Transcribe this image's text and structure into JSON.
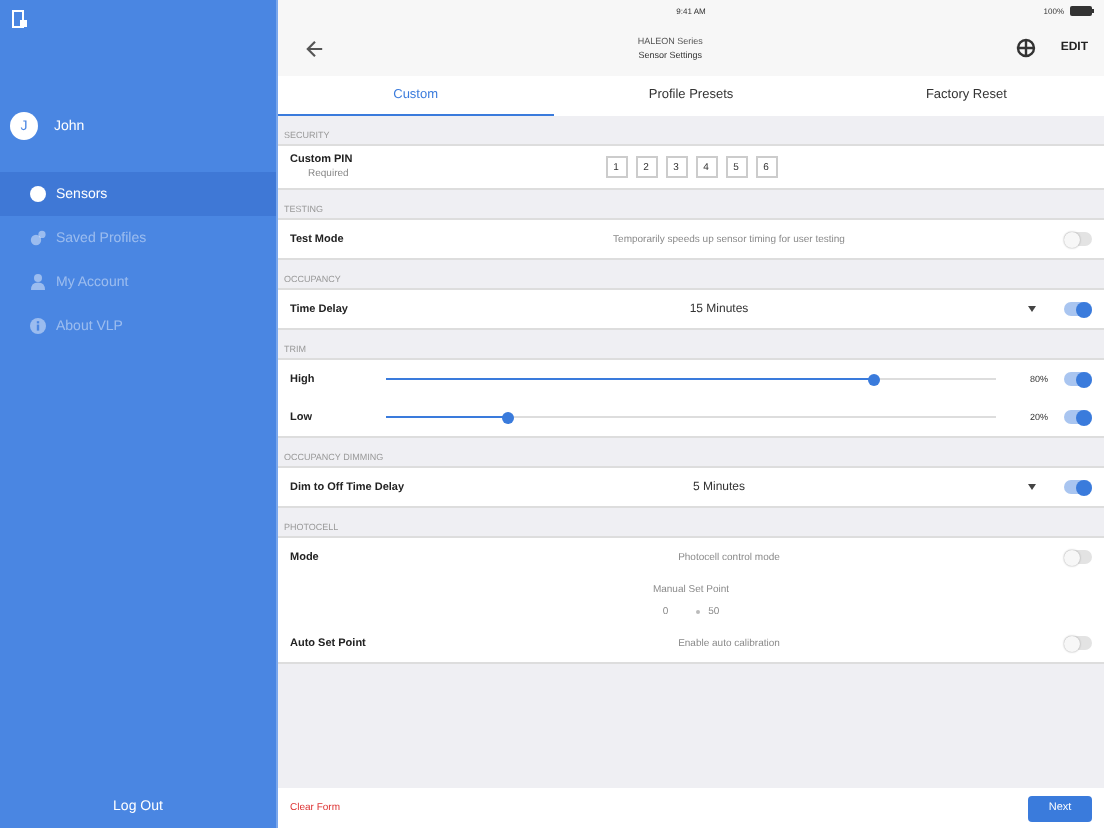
{
  "status_bar": {
    "time": "9:41 AM",
    "battery": "100%"
  },
  "sidebar": {
    "user": {
      "initial": "J",
      "name": "John"
    },
    "items": [
      {
        "label": "Sensors",
        "selected": true
      },
      {
        "label": "Saved Profiles",
        "selected": false
      },
      {
        "label": "My Account",
        "selected": false
      },
      {
        "label": "About VLP",
        "selected": false
      }
    ],
    "logout": "Log Out"
  },
  "header": {
    "subtitle": "HALEON Series",
    "title": "Sensor Settings",
    "edit": "EDIT"
  },
  "tabs": [
    {
      "label": "Custom",
      "selected": true
    },
    {
      "label": "Profile Presets",
      "selected": false
    },
    {
      "label": "Factory Reset",
      "selected": false
    }
  ],
  "sections": [
    {
      "title": "SECURITY",
      "rows": [
        {
          "kind": "pin",
          "label": "Custom PIN",
          "sublabel": "Required",
          "digits": [
            "1",
            "2",
            "3",
            "4",
            "5",
            "6"
          ]
        }
      ]
    },
    {
      "title": "TESTING",
      "rows": [
        {
          "kind": "toggle",
          "label": "Test Mode",
          "description": "Temporarily speeds up sensor timing for user testing",
          "on": false
        }
      ]
    },
    {
      "title": "OCCUPANCY",
      "rows": [
        {
          "kind": "select",
          "label": "Time Delay",
          "value": "15 Minutes",
          "on": true
        }
      ]
    },
    {
      "title": "TRIM",
      "rows": [
        {
          "kind": "slider",
          "label": "High",
          "level": 0.8,
          "reading": "80%",
          "on": true
        },
        {
          "kind": "slider",
          "label": "Low",
          "level": 0.2,
          "reading": "20%",
          "on": true
        }
      ]
    },
    {
      "title": "OCCUPANCY DIMMING",
      "rows": [
        {
          "kind": "select",
          "label": "Dim to Off Time Delay",
          "value": "5 Minutes",
          "on": true
        }
      ]
    },
    {
      "title": "PHOTOCELL",
      "rows": [
        {
          "kind": "toggle",
          "label": "Mode",
          "description": "Photocell control mode",
          "on": false
        },
        {
          "kind": "setpoint",
          "label": "Manual Set Point",
          "low": "0",
          "high": "50"
        },
        {
          "kind": "toggle",
          "label": "Auto Set Point",
          "description": "Enable auto calibration",
          "on": false
        }
      ]
    }
  ],
  "footer": {
    "clear": "Clear Form",
    "next": "Next"
  }
}
